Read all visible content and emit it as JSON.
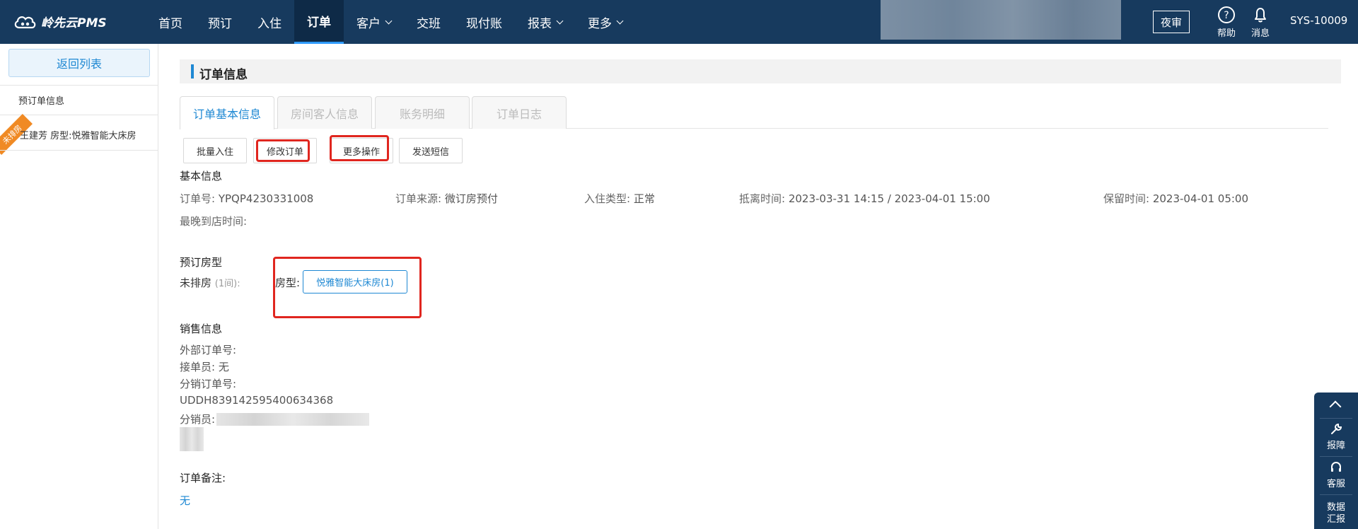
{
  "brand": {
    "name": "岭先云PMS"
  },
  "nav": [
    {
      "label": "首页",
      "dropdown": false,
      "active": false
    },
    {
      "label": "预订",
      "dropdown": false,
      "active": false
    },
    {
      "label": "入住",
      "dropdown": false,
      "active": false
    },
    {
      "label": "订单",
      "dropdown": false,
      "active": true
    },
    {
      "label": "客户",
      "dropdown": true,
      "active": false
    },
    {
      "label": "交班",
      "dropdown": false,
      "active": false
    },
    {
      "label": "现付账",
      "dropdown": false,
      "active": false
    },
    {
      "label": "报表",
      "dropdown": true,
      "active": false
    },
    {
      "label": "更多",
      "dropdown": true,
      "active": false
    }
  ],
  "header": {
    "night_audit": "夜审",
    "help": "帮助",
    "messages": "消息",
    "user": "SYS-10009"
  },
  "sidebar": {
    "back": "返回列表",
    "section_label": "预订单信息",
    "ribbon": "未排房",
    "item": "王建芳   房型:悦雅智能大床房"
  },
  "section": {
    "title": "订单信息"
  },
  "tabs": [
    {
      "label": "订单基本信息",
      "active": true
    },
    {
      "label": "房间客人信息",
      "active": false
    },
    {
      "label": "账务明细",
      "active": false
    },
    {
      "label": "订单日志",
      "active": false
    }
  ],
  "actions": {
    "batch_checkin": "批量入住",
    "modify_order": "修改订单",
    "more_ops": "更多操作",
    "send_sms": "发送短信"
  },
  "basic": {
    "title": "基本信息",
    "order_no_label": "订单号:",
    "order_no": "YPQP4230331008",
    "source_label": "订单来源:",
    "source": "微订房预付",
    "checkin_type_label": "入住类型:",
    "checkin_type": "正常",
    "stay_label": "抵离时间:",
    "stay": "2023-03-31 14:15 / 2023-04-01 15:00",
    "hold_label": "保留时间:",
    "hold": "2023-04-01 05:00",
    "latest_arrival_label": "最晚到店时间:"
  },
  "booking": {
    "title": "预订房型",
    "unassigned": "未排房",
    "count": "(1间)",
    "colon": ":",
    "roomtype_label": "房型:",
    "roomtype_button": "悦雅智能大床房(1)"
  },
  "sales": {
    "title": "销售信息",
    "external_order": "外部订单号:",
    "receiver": "接单员: 无",
    "dist_order_label": "分销订单号:",
    "dist_order": "UDDH839142595400634368",
    "distributor": "分销员:"
  },
  "remark": {
    "title": "订单备注:",
    "value": "无"
  },
  "float_panel": {
    "report_issue": "报障",
    "service": "客服",
    "data_report_1": "数据",
    "data_report_2": "汇报"
  }
}
